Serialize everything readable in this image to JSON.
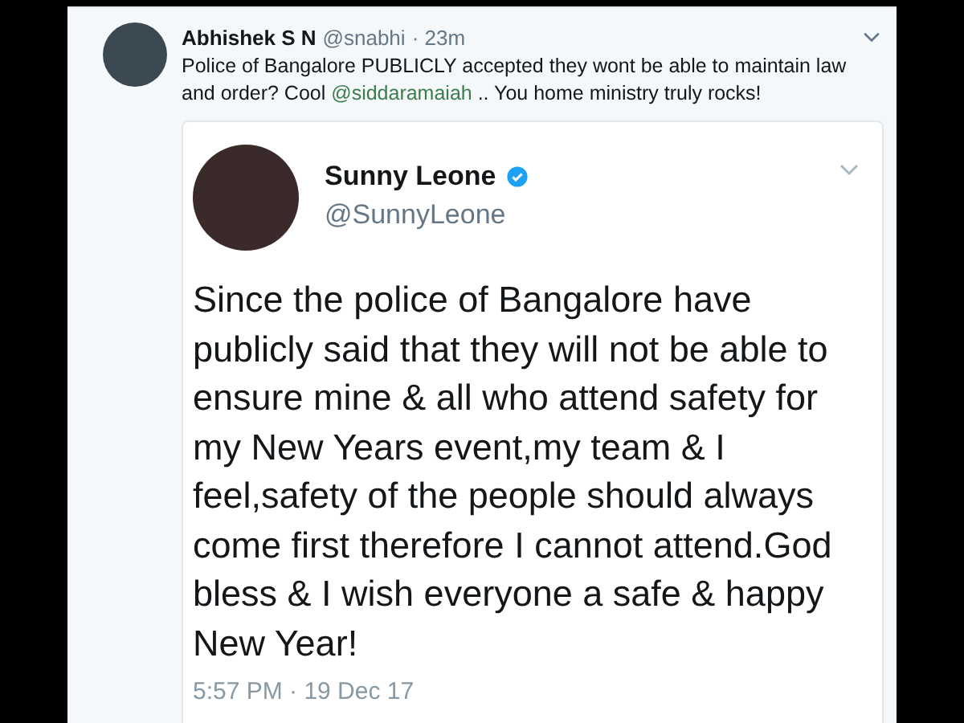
{
  "tweet": {
    "author": {
      "name": "Abhishek S N",
      "handle": "@snabhi",
      "time": "· 23m"
    },
    "text": [
      {
        "kind": "text",
        "value": "Police of Bangalore PUBLICLY accepted they wont be able to maintain law and order? Cool "
      },
      {
        "kind": "mention",
        "value": "@siddaramaiah"
      },
      {
        "kind": "text",
        "value": " ..  You home ministry truly rocks!"
      }
    ],
    "quoted": {
      "name": "Sunny Leone",
      "verified": true,
      "handle": "@SunnyLeone",
      "text": "Since the police of Bangalore have publicly said that they will not be able to ensure mine & all who attend safety for my New Years event,my team & I feel,safety of the people should always come first therefore I cannot attend.God bless & I wish everyone a safe & happy New Year!",
      "timestamp": "5:57 PM · 19 Dec 17"
    }
  }
}
